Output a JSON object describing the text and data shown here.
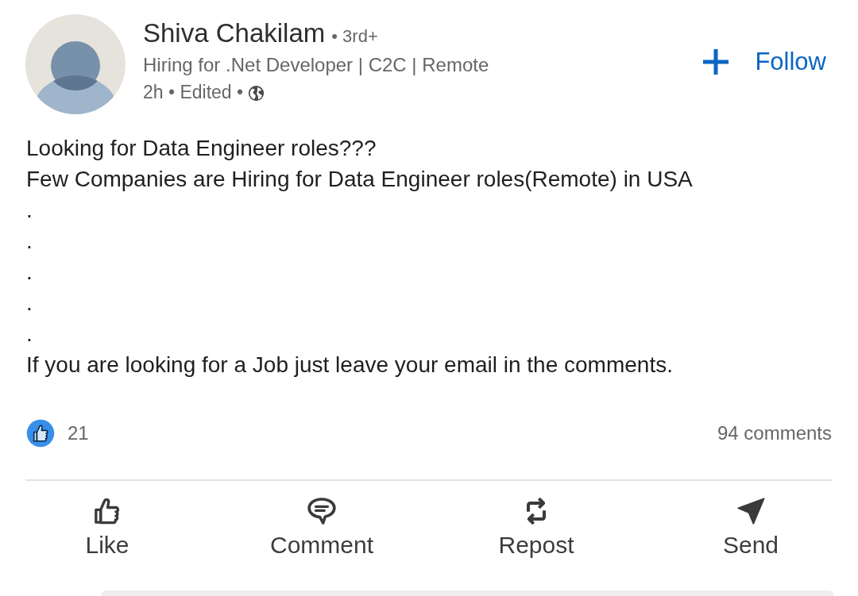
{
  "author": {
    "name": "Shiva Chakilam",
    "degree": "• 3rd+",
    "headline": "Hiring for .Net Developer | C2C | Remote",
    "meta": "2h • Edited •"
  },
  "follow_button": {
    "label": "Follow"
  },
  "post": {
    "lines": [
      "Looking for Data Engineer roles???",
      "Few Companies are Hiring for Data Engineer roles(Remote) in USA",
      ".",
      ".",
      ".",
      ".",
      ".",
      "If you are looking for a Job just leave your email in the comments."
    ]
  },
  "social_counts": {
    "reactions": "21",
    "comments": "94 comments"
  },
  "actions": [
    {
      "kind": "like",
      "label": "Like"
    },
    {
      "kind": "comment",
      "label": "Comment"
    },
    {
      "kind": "repost",
      "label": "Repost"
    },
    {
      "kind": "send",
      "label": "Send"
    }
  ]
}
